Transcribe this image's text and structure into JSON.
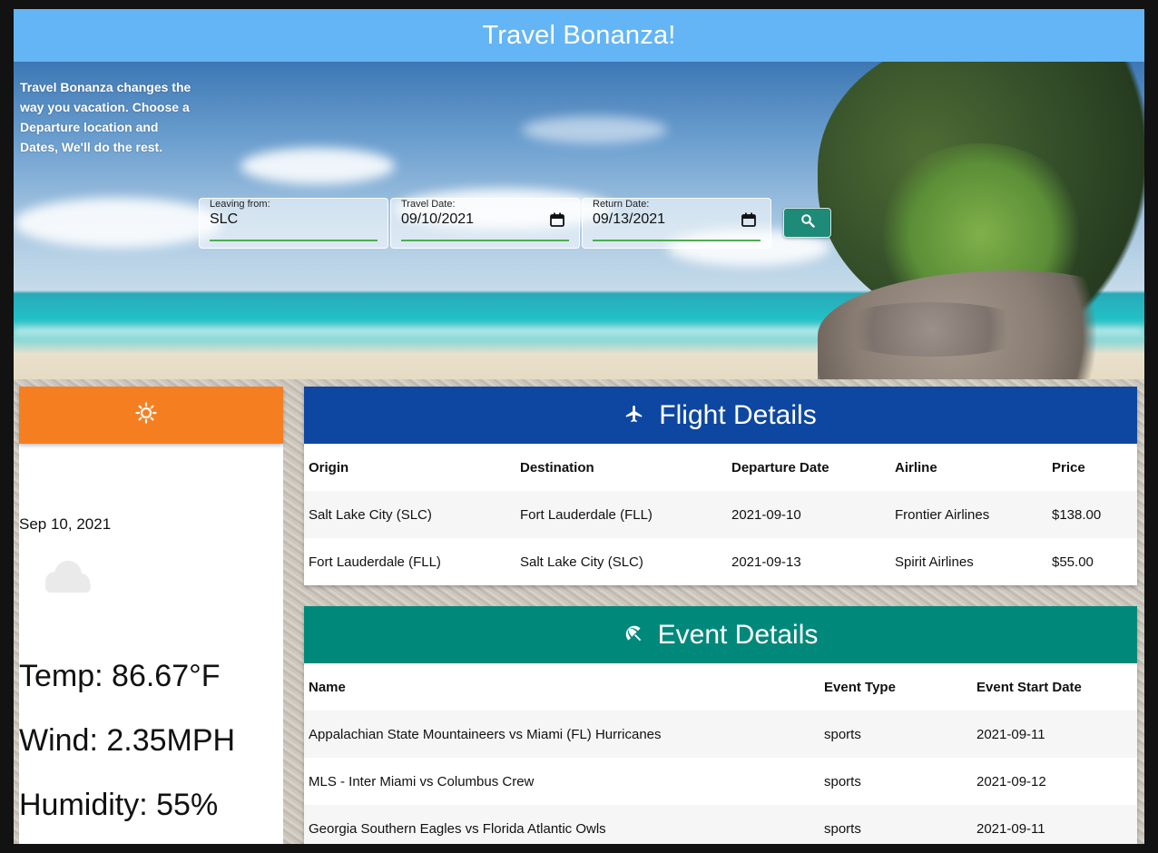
{
  "app": {
    "title": "Travel Bonanza!"
  },
  "hero": {
    "intro": "Travel Bonanza changes the way you vacation. Choose a Departure location and Dates, We'll do the rest."
  },
  "search": {
    "leaving": {
      "label": "Leaving from:",
      "value": "SLC"
    },
    "travel_date": {
      "label": "Travel Date:",
      "value": "09/10/2021"
    },
    "return_date": {
      "label": "Return Date:",
      "value": "09/13/2021"
    },
    "button_icon": "search-icon"
  },
  "weather": {
    "header_icon": "sun-icon",
    "date": "Sep 10, 2021",
    "condition_icon": "cloud-icon",
    "temp": "Temp: 86.67°F",
    "wind": "Wind: 2.35MPH",
    "humidity": "Humidity: 55%"
  },
  "flights": {
    "title": "Flight Details",
    "icon": "airplane-icon",
    "columns": [
      "Origin",
      "Destination",
      "Departure Date",
      "Airline",
      "Price"
    ],
    "rows": [
      [
        "Salt Lake City (SLC)",
        "Fort Lauderdale (FLL)",
        "2021-09-10",
        "Frontier Airlines",
        "$138.00"
      ],
      [
        "Fort Lauderdale (FLL)",
        "Salt Lake City (SLC)",
        "2021-09-13",
        "Spirit Airlines",
        "$55.00"
      ]
    ]
  },
  "events": {
    "title": "Event Details",
    "icon": "beach-umbrella-icon",
    "columns": [
      "Name",
      "Event Type",
      "Event Start Date"
    ],
    "rows": [
      [
        "Appalachian State Mountaineers vs Miami (FL) Hurricanes",
        "sports",
        "2021-09-11"
      ],
      [
        "MLS - Inter Miami vs Columbus Crew",
        "sports",
        "2021-09-12"
      ],
      [
        "Georgia Southern Eagles vs Florida Atlantic Owls",
        "sports",
        "2021-09-11"
      ]
    ]
  },
  "colors": {
    "header": "#64b5f6",
    "weather_header": "#f57f20",
    "flight_header": "#0d47a1",
    "event_header": "#00897b",
    "search_button": "#1e8a78",
    "input_underline": "#4caf50"
  }
}
